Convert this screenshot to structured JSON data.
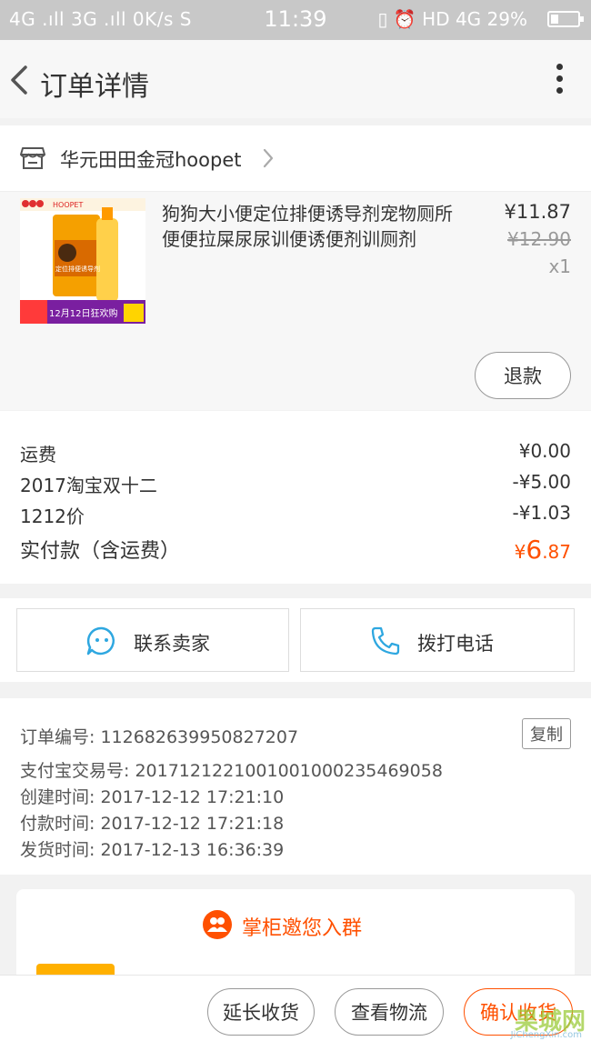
{
  "status_bar": {
    "left": "4G .ıll 3G .ıll 0K/s S",
    "time": "11:39",
    "right": "HD 4G 29%",
    "battery_percent": 29
  },
  "header": {
    "title": "订单详情"
  },
  "shop": {
    "name": "华元田田金冠hoopet"
  },
  "product": {
    "title": "狗狗大小便定位排便诱导剂宠物厕所便便拉屎尿尿训便诱便剂训厕剂",
    "price": "¥11.87",
    "original_price": "¥12.90",
    "quantity": "x1",
    "image_brand": "HOOPET",
    "image_caption": "定位排便诱导剂",
    "image_banner": "12月12日狂欢购",
    "refund_label": "退款"
  },
  "totals": {
    "rows": [
      {
        "label": "运费",
        "value": "¥0.00"
      },
      {
        "label": "2017淘宝双十二",
        "value": "-¥5.00"
      },
      {
        "label": "1212价",
        "value": "-¥1.03"
      }
    ],
    "paid_label": "实付款（含运费）",
    "paid_currency": "¥",
    "paid_int": "6",
    "paid_dec": ".87"
  },
  "contact": {
    "seller_label": "联系卖家",
    "call_label": "拨打电话"
  },
  "order_info": {
    "order_no": "订单编号: 112682639950827207",
    "alipay_no": "支付宝交易号: 2017121221001001000235469058",
    "created": "创建时间: 2017-12-12 17:21:10",
    "paid": "付款时间: 2017-12-12 17:21:18",
    "shipped": "发货时间: 2017-12-13 16:36:39",
    "copy_label": "复制"
  },
  "group_card": {
    "title": "掌柜邀您入群"
  },
  "bottom_bar": {
    "extend_label": "延长收货",
    "logistics_label": "查看物流",
    "confirm_label": "确认收货"
  },
  "watermark": {
    "text": "果城网",
    "sub": "JiChengXin.com"
  },
  "colors": {
    "accent": "#ff5000",
    "icon_blue": "#2ea7e0"
  }
}
